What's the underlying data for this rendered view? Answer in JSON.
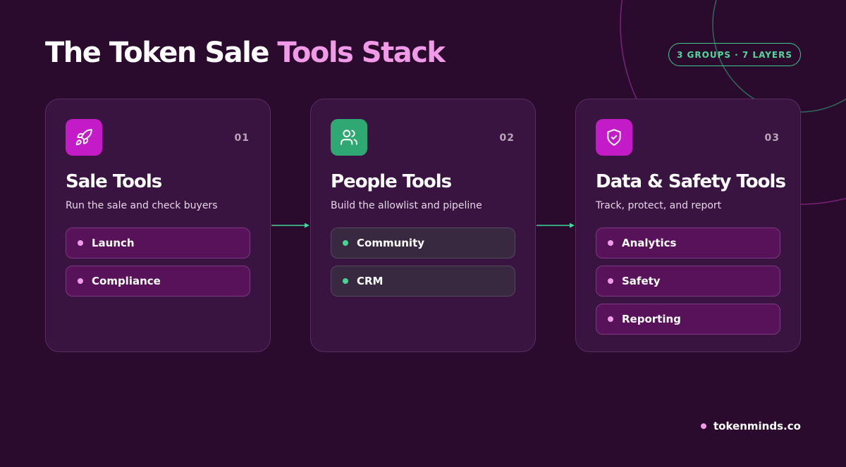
{
  "header": {
    "title_main": "The Token Sale",
    "title_accent": "Tools Stack",
    "badge": "3 GROUPS · 7 LAYERS"
  },
  "cards": [
    {
      "number": "01",
      "title": "Sale Tools",
      "subtitle": "Run the sale and check buyers",
      "icon": "rocket-icon",
      "accent": "#c21bc7",
      "items": [
        {
          "label": "Launch"
        },
        {
          "label": "Compliance"
        }
      ]
    },
    {
      "number": "02",
      "title": "People Tools",
      "subtitle": "Build the allowlist and pipeline",
      "icon": "users-icon",
      "accent": "#2fa874",
      "items": [
        {
          "label": "Community"
        },
        {
          "label": "CRM"
        }
      ]
    },
    {
      "number": "03",
      "title": "Data & Safety Tools",
      "subtitle": "Track, protect, and report",
      "icon": "shield-check-icon",
      "accent": "#c21bc7",
      "items": [
        {
          "label": "Analytics"
        },
        {
          "label": "Safety"
        },
        {
          "label": "Reporting"
        }
      ]
    }
  ],
  "footer": {
    "brand": "tokenminds.co"
  },
  "colors": {
    "background": "#2a0b2e",
    "accent_pink": "#f19ae8",
    "accent_green": "#3fc98c"
  }
}
